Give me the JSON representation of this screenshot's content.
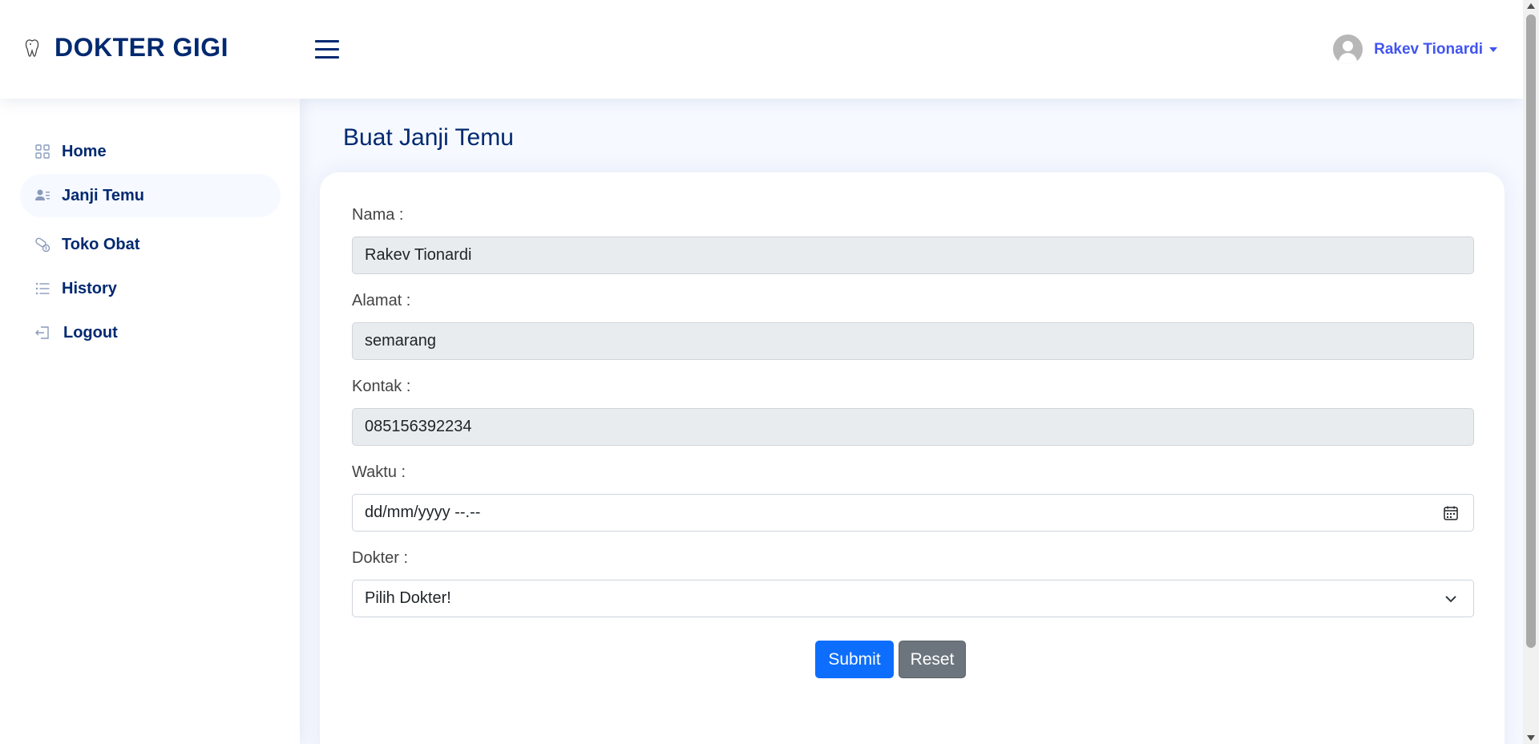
{
  "app": {
    "title": "DOKTER GIGI",
    "logo_icon": "tooth-icon"
  },
  "header": {
    "menu_icon": "hamburger-icon",
    "profile": {
      "name": "Rakev Tionardi",
      "avatar_icon": "user-avatar-icon"
    }
  },
  "sidebar": {
    "items": [
      {
        "label": "Home",
        "icon": "grid-icon"
      },
      {
        "label": "Janji Temu",
        "icon": "person-lines-icon",
        "active": true
      },
      {
        "label": "Toko Obat",
        "icon": "capsule-icon"
      },
      {
        "label": "History",
        "icon": "list-icon"
      },
      {
        "label": "Logout",
        "icon": "logout-icon"
      }
    ]
  },
  "main": {
    "page_title": "Buat Janji Temu",
    "form": {
      "nama": {
        "label": "Nama :",
        "value": "Rakev Tionardi"
      },
      "alamat": {
        "label": "Alamat :",
        "value": "semarang"
      },
      "kontak": {
        "label": "Kontak :",
        "value": "085156392234"
      },
      "waktu": {
        "label": "Waktu :",
        "placeholder": "dd/mm/yyyy --.--"
      },
      "dokter": {
        "label": "Dokter :",
        "selected": "Pilih Dokter!"
      },
      "submit_label": "Submit",
      "reset_label": "Reset"
    }
  },
  "colors": {
    "primary": "#012970",
    "accent": "#4154f1",
    "submit": "#0d6efd",
    "reset": "#6c757d",
    "background": "#f6f9ff"
  }
}
